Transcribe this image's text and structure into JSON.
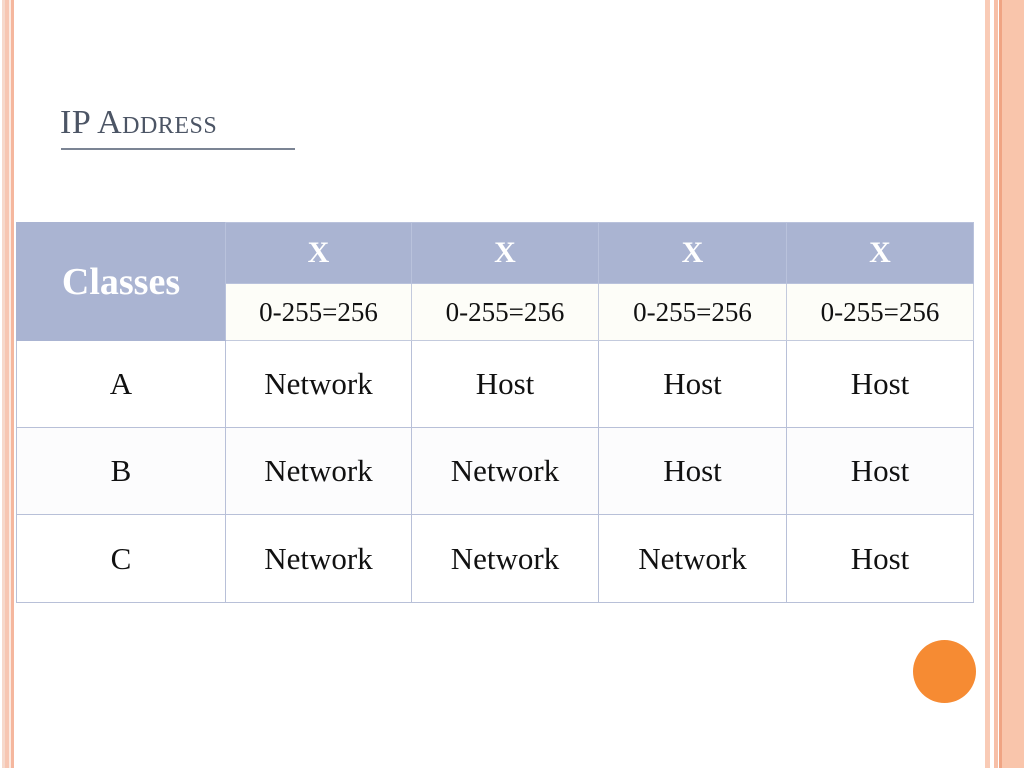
{
  "slide": {
    "title": "IP Address",
    "background_color": "#ffffff",
    "accent_color": "#f68b33",
    "header_color": "#aab4d2",
    "title_color": "#4c5565"
  },
  "decor": {
    "left_stripes": [
      "#f6d9cc",
      "#f7c6b2",
      "#fbe9e0",
      "#f5b79e"
    ],
    "right_stripes": [
      "#f9cbb6",
      "#f7bfa7",
      "#f0a483",
      "#f9c5ab"
    ],
    "dot_label": "orange-circle-decoration"
  },
  "table": {
    "header_row": {
      "classes_label": "Classes",
      "octets": [
        "X",
        "X",
        "X",
        "X"
      ]
    },
    "range_row": {
      "ranges": [
        "0-255=256",
        "0-255=256",
        "0-255=256",
        "0-255=256"
      ]
    },
    "rows": [
      {
        "class": "A",
        "octets": [
          "Network",
          "Host",
          "Host",
          "Host"
        ]
      },
      {
        "class": "B",
        "octets": [
          "Network",
          "Network",
          "Host",
          "Host"
        ]
      },
      {
        "class": "C",
        "octets": [
          "Network",
          "Network",
          "Network",
          "Host"
        ]
      }
    ]
  }
}
